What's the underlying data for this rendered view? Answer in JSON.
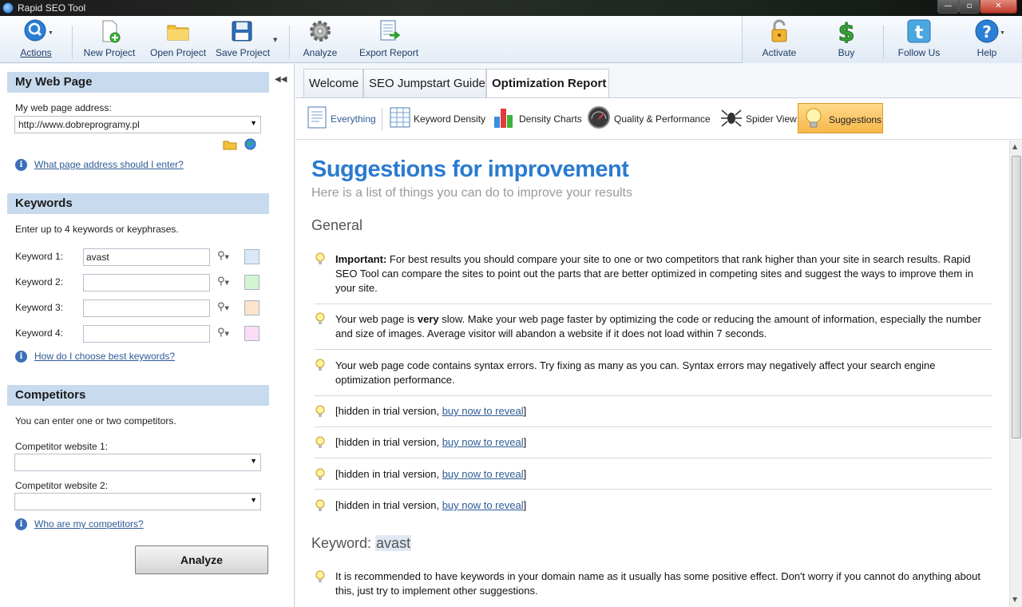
{
  "window": {
    "title": "Rapid SEO Tool",
    "minimize": "—",
    "maximize": "▫",
    "close": "✕"
  },
  "toolbar": {
    "actions": "Actions",
    "new_project": "New Project",
    "open_project": "Open Project",
    "save_project": "Save Project",
    "analyze": "Analyze",
    "export_report": "Export Report",
    "activate": "Activate",
    "buy": "Buy",
    "follow_us": "Follow Us",
    "help": "Help"
  },
  "my_web_page": {
    "header": "My Web Page",
    "address_label": "My web page address:",
    "address_value": "http://www.dobreprogramy.pl",
    "help_link": "What page address should I enter?"
  },
  "keywords": {
    "header": "Keywords",
    "intro": "Enter up to 4 keywords or keyphrases.",
    "items": [
      {
        "label": "Keyword 1:",
        "value": "avast",
        "color": "#dbe8f8"
      },
      {
        "label": "Keyword 2:",
        "value": "",
        "color": "#d3f5d0"
      },
      {
        "label": "Keyword 3:",
        "value": "",
        "color": "#fde3cc"
      },
      {
        "label": "Keyword 4:",
        "value": "",
        "color": "#fbdcf6"
      }
    ],
    "help_link": "How do I choose best keywords?"
  },
  "competitors": {
    "header": "Competitors",
    "intro": "You can enter one or two competitors.",
    "site1_label": "Competitor website 1:",
    "site1_value": "",
    "site2_label": "Competitor website 2:",
    "site2_value": "",
    "help_link": "Who are my competitors?"
  },
  "analyze_button": "Analyze",
  "tabs": [
    "Welcome",
    "SEO Jumpstart Guide",
    "Optimization Report"
  ],
  "views": [
    "Everything",
    "Keyword Density",
    "Density Charts",
    "Quality & Performance",
    "Spider View",
    "Suggestions"
  ],
  "report": {
    "title": "Suggestions for improvement",
    "subtitle": "Here is a list of things you can do to improve your results",
    "general_title": "General",
    "s1_bold": "Important:",
    "s1_text": " For best results you should compare your site to one or two competitors that rank higher than your site in search results. Rapid SEO Tool can compare the sites to point out the parts that are better optimized in competing sites and suggest the ways to improve them in your site.",
    "s2_pre": "Your web page is ",
    "s2_bold": "very",
    "s2_post": " slow. Make your web page faster by optimizing the code or reducing the amount of information, especially the number and size of images. Average visitor will abandon a website if it does not load within 7 seconds.",
    "s3_text": "Your web page code contains syntax errors. Try fixing as many as you can. Syntax errors may negatively affect your search engine optimization performance.",
    "hidden_pre": "[hidden in trial version, ",
    "hidden_link": "buy now to reveal",
    "hidden_post": "]",
    "keyword_title": "Keyword: ",
    "keyword_value": "avast",
    "k1_text": "It is recommended to have keywords in your domain name as it usually has some positive effect. Don't worry if you cannot do anything about this, just try to implement other suggestions."
  }
}
